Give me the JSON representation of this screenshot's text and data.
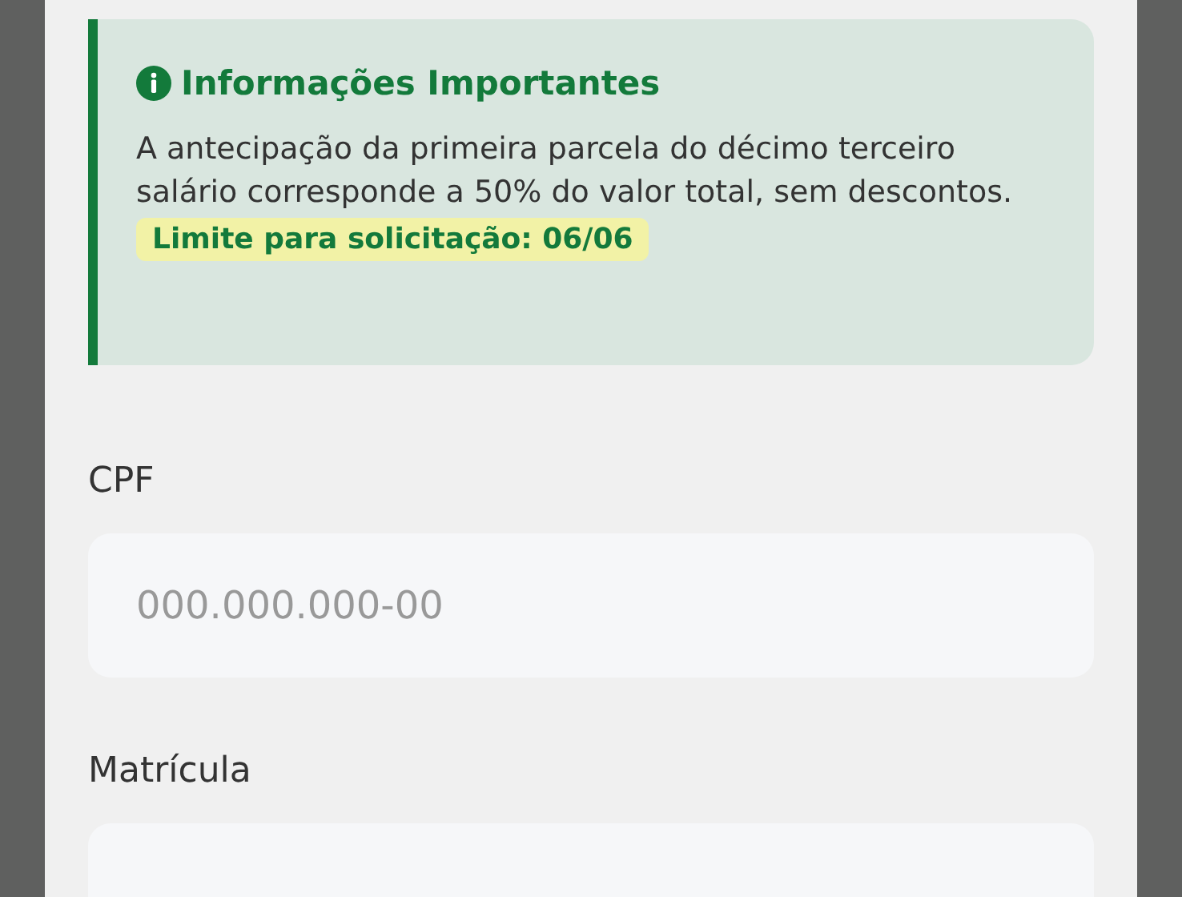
{
  "info_box": {
    "title": "Informações Importantes",
    "body": "A antecipação da primeira parcela do décimo terceiro salário corresponde a 50% do valor total, sem descontos.",
    "highlight": "Limite para solicitação: 06/06"
  },
  "fields": [
    {
      "label": "CPF",
      "placeholder": "000.000.000-00"
    },
    {
      "label": "Matrícula"
    }
  ]
}
